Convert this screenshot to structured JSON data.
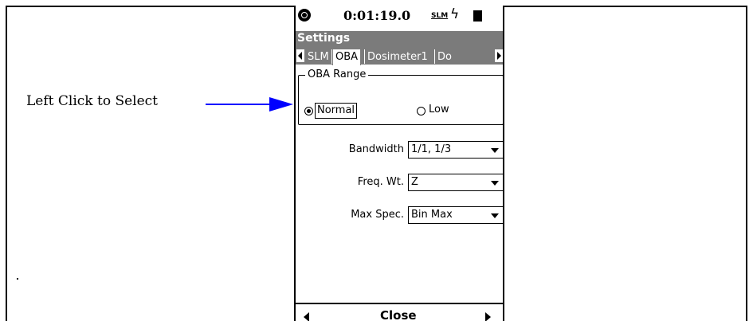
{
  "annotation": {
    "text": "Left Click to Select",
    "arrow_color": "#0000ff"
  },
  "status": {
    "time": "0:01:19.0",
    "mode": "SLM",
    "bolt": "ϟ"
  },
  "title": "Settings",
  "tabs": [
    {
      "label": "SLM",
      "active": false
    },
    {
      "label": "OBA",
      "active": true
    },
    {
      "label": "Dosimeter1",
      "active": false
    },
    {
      "label": "Do",
      "active": false
    }
  ],
  "oba_range": {
    "legend": "OBA Range",
    "options": [
      {
        "label": "Normal",
        "selected": true
      },
      {
        "label": "Low",
        "selected": false
      }
    ]
  },
  "fields": {
    "bandwidth": {
      "label": "Bandwidth",
      "value": "1/1, 1/3"
    },
    "freq_wt": {
      "label": "Freq. Wt.",
      "value": "Z"
    },
    "max_spec": {
      "label": "Max Spec.",
      "value": "Bin Max"
    }
  },
  "footer": {
    "close_label": "Close"
  },
  "colors": {
    "header_gray": "#7b7b7b"
  }
}
